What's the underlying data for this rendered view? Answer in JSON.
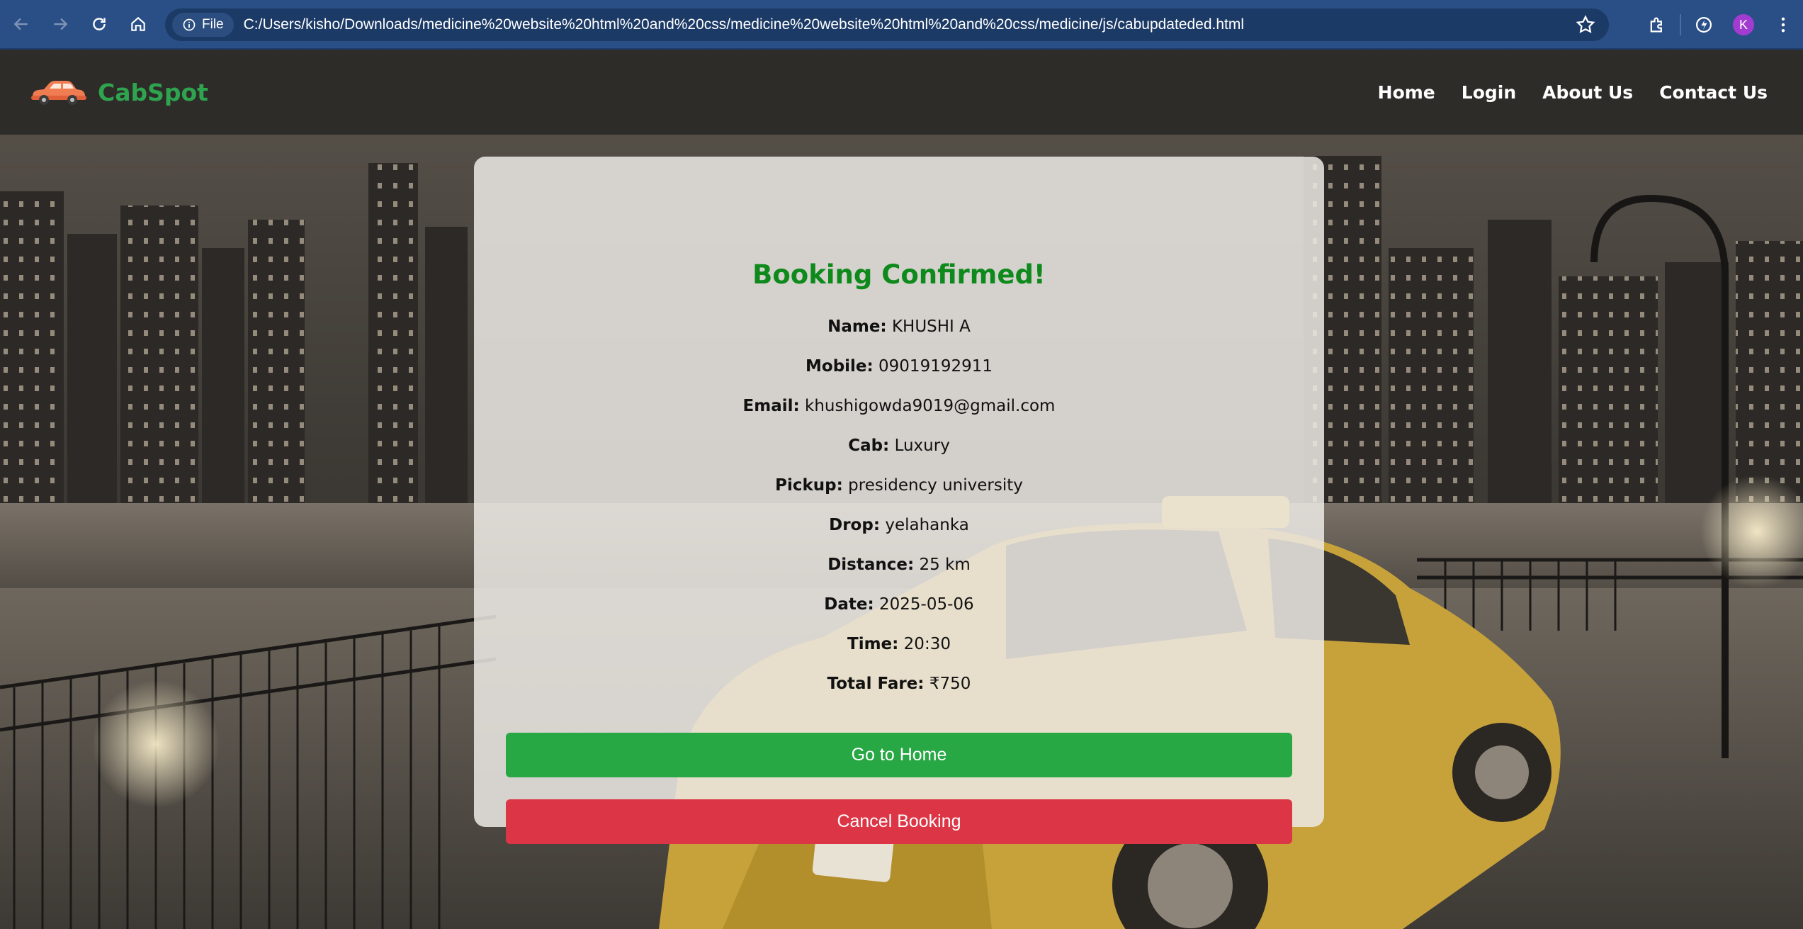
{
  "browser": {
    "site_chip_label": "File",
    "url": "C:/Users/kisho/Downloads/medicine%20website%20html%20and%20css/medicine%20website%20html%20and%20css/medicine/js/cabupdateded.html",
    "profile_initial": "K"
  },
  "header": {
    "brand": "CabSpot",
    "nav": [
      "Home",
      "Login",
      "About Us",
      "Contact Us"
    ]
  },
  "booking": {
    "title": "Booking Confirmed!",
    "fields": [
      {
        "label": "Name:",
        "value": "KHUSHI A"
      },
      {
        "label": "Mobile:",
        "value": "09019192911"
      },
      {
        "label": "Email:",
        "value": "khushigowda9019@gmail.com"
      },
      {
        "label": "Cab:",
        "value": "Luxury"
      },
      {
        "label": "Pickup:",
        "value": "presidency university"
      },
      {
        "label": "Drop:",
        "value": "yelahanka"
      },
      {
        "label": "Distance:",
        "value": "25 km"
      },
      {
        "label": "Date:",
        "value": "2025-05-06"
      },
      {
        "label": "Time:",
        "value": "20:30"
      },
      {
        "label": "Total Fare:",
        "value": "₹750"
      }
    ],
    "home_button": "Go to Home",
    "cancel_button": "Cancel Booking"
  },
  "colors": {
    "brand_green": "#2ea44f",
    "title_green": "#0e8a1c",
    "home_button": "#28a745",
    "cancel_button": "#dc3545",
    "chrome_blue": "#2a4f86"
  },
  "icons": [
    "back-icon",
    "forward-icon",
    "reload-icon",
    "home-icon",
    "info-icon",
    "star-icon",
    "extensions-icon",
    "performance-icon",
    "menu-icon",
    "car-logo-icon"
  ]
}
